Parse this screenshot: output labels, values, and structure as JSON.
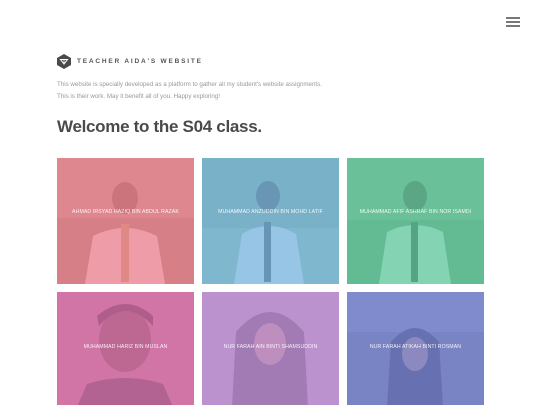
{
  "site": {
    "title": "Teacher Aida's Website",
    "intro_line1": "This website is specially developed as a platform to gather all my student's website assignments.",
    "intro_line2": "This is their work. May it benefit all of you. Happy exploring!",
    "heading": "Welcome to the S04 class."
  },
  "students": [
    {
      "name": "AHMAD IRSYAD HAZIQ BIN ABDUL RAZAK",
      "overlay": "#e8808f"
    },
    {
      "name": "MUHAMMAD ANZUDDIN BIN MOHD LATIF",
      "overlay": "#7bb7e0"
    },
    {
      "name": "MUHAMMAD AFIF ASHRAF BIN NOR ISAMDI",
      "overlay": "#64c9a0"
    },
    {
      "name": "MUHAMMAD HARIZ BIN MUSLAN",
      "overlay": "#d873b0"
    },
    {
      "name": "NUR FARAH AIN BINTI SHAMSUDDIN",
      "overlay": "#c090d6"
    },
    {
      "name": "NUR FARAH ATIKAH BINTI ROSMAN",
      "overlay": "#7c86d4"
    }
  ],
  "icons": {
    "menu": "hamburger-menu-icon",
    "logo": "hexagon-logo-icon"
  }
}
